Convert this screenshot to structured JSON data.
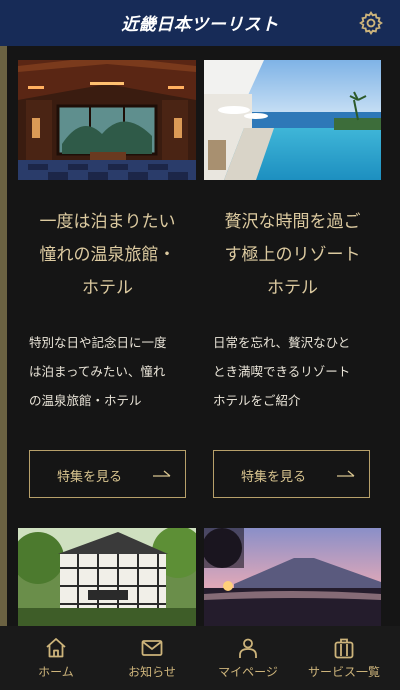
{
  "header": {
    "logo_text": "近畿日本ツーリスト",
    "settings_icon": "gear-icon"
  },
  "cards": [
    {
      "image_alt": "旅館の客室と庭園の景色",
      "title_line1": "一度は泊まりたい",
      "title_line2": "憧れの温泉旅館・",
      "title_line3": "ホテル",
      "desc_line1": "特別な日や記念日に一度",
      "desc_line2": "は泊まってみたい、憧れ",
      "desc_line3": "の温泉旅館・ホテル",
      "button_label": "特集を見る",
      "button_icon": "long-arrow-right-icon"
    },
    {
      "image_alt": "海を望むリゾートのインフィニティプール",
      "title_line1": "贅沢な時間を過ご",
      "title_line2": "す極上のリゾート",
      "title_line3": "ホテル",
      "desc_line1": "日常を忘れ、贅沢なひと",
      "desc_line2": "とき満喫できるリゾート",
      "desc_line3": "ホテルをご紹介",
      "button_label": "特集を見る",
      "button_icon": "long-arrow-right-icon"
    }
  ],
  "lower_images": [
    {
      "image_alt": "緑に囲まれた洋館ホテル"
    },
    {
      "image_alt": "夕景の山と露天風呂"
    }
  ],
  "tabbar": {
    "items": [
      {
        "label": "ホーム",
        "icon": "home-icon"
      },
      {
        "label": "お知らせ",
        "icon": "envelope-icon"
      },
      {
        "label": "マイページ",
        "icon": "person-icon"
      },
      {
        "label": "サービス一覧",
        "icon": "suitcase-icon"
      }
    ]
  },
  "colors": {
    "header_bg": "#172b57",
    "page_bg": "#151515",
    "accent_gold": "#cdb47b",
    "title_gold": "#dccaa0",
    "tabbar_bg": "#1a1a1a"
  }
}
